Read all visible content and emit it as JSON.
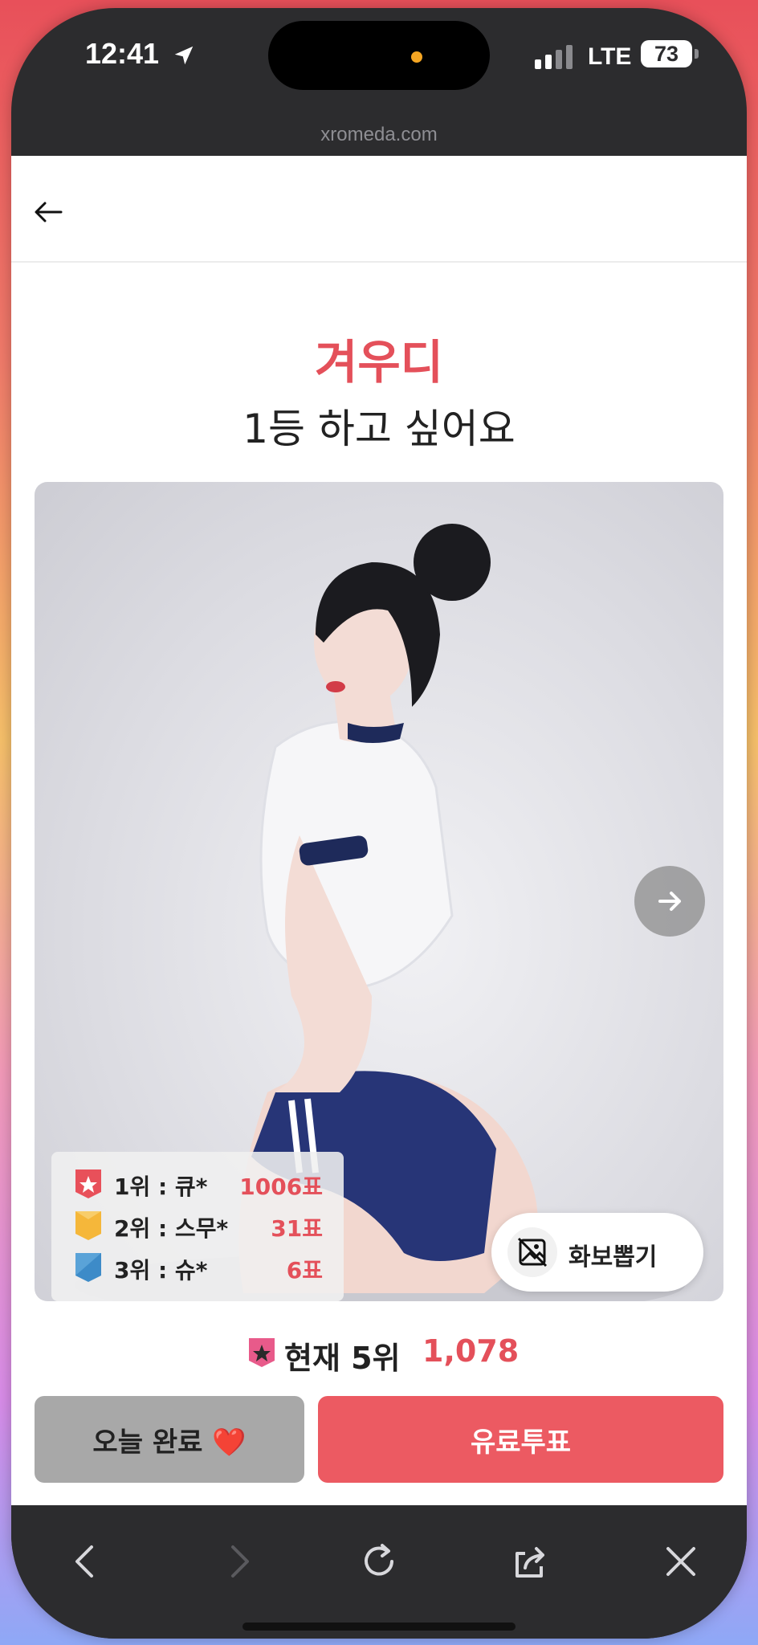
{
  "status_bar": {
    "time": "12:41",
    "network": "LTE",
    "battery": "73"
  },
  "browser": {
    "url": "xromeda.com"
  },
  "header": {
    "back_icon": "arrow-left-icon"
  },
  "profile": {
    "name": "겨우디",
    "message": "1등 하고 싶어요"
  },
  "ranking": {
    "rows": [
      {
        "label": "1위 : 큐*",
        "votes": "1006표",
        "medal_color": "#e8505a"
      },
      {
        "label": "2위 : 스무*",
        "votes": "31표",
        "medal_color": "#f5b73a"
      },
      {
        "label": "3위 : 슈*",
        "votes": "6표",
        "medal_color": "#3d8bc8"
      }
    ]
  },
  "photo_button": {
    "label": "화보뽑기"
  },
  "current_rank": {
    "label": "현재 5위",
    "value": "1,078"
  },
  "buttons": {
    "done_label": "오늘 완료 ❤️",
    "paid_label": "유료투표"
  },
  "colors": {
    "accent": "#e4505a",
    "paid_button": "#ec5a62",
    "done_button": "#a8a8a8"
  }
}
